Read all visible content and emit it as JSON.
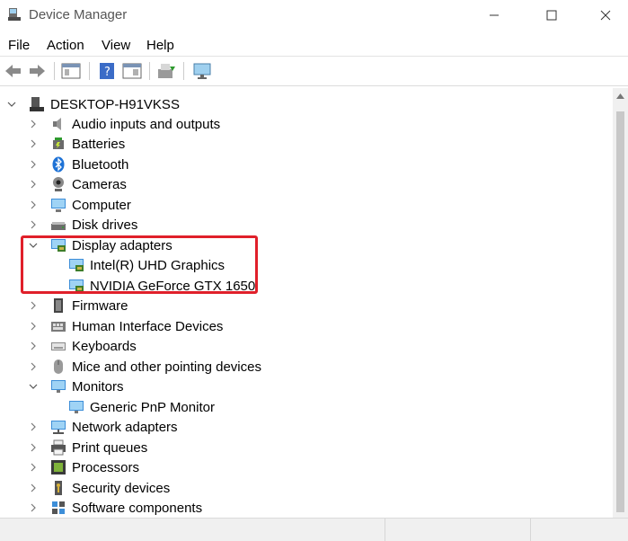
{
  "window": {
    "title": "Device Manager"
  },
  "menu": [
    "File",
    "Action",
    "View",
    "Help"
  ],
  "tree": {
    "root": "DESKTOP-H91VKSS",
    "items": [
      {
        "label": "Audio inputs and outputs",
        "icon": "speaker-icon",
        "expanded": false
      },
      {
        "label": "Batteries",
        "icon": "battery-icon",
        "expanded": false
      },
      {
        "label": "Bluetooth",
        "icon": "bluetooth-icon",
        "expanded": false
      },
      {
        "label": "Cameras",
        "icon": "camera-icon",
        "expanded": false
      },
      {
        "label": "Computer",
        "icon": "computer-icon",
        "expanded": false
      },
      {
        "label": "Disk drives",
        "icon": "disk-drive-icon",
        "expanded": false
      },
      {
        "label": "Display adapters",
        "icon": "display-adapter-icon",
        "expanded": true,
        "children": [
          {
            "label": "Intel(R) UHD Graphics",
            "icon": "display-adapter-icon"
          },
          {
            "label": "NVIDIA GeForce GTX 1650",
            "icon": "display-adapter-icon"
          }
        ]
      },
      {
        "label": "Firmware",
        "icon": "firmware-icon",
        "expanded": false
      },
      {
        "label": "Human Interface Devices",
        "icon": "hid-icon",
        "expanded": false
      },
      {
        "label": "Keyboards",
        "icon": "keyboard-icon",
        "expanded": false
      },
      {
        "label": "Mice and other pointing devices",
        "icon": "mouse-icon",
        "expanded": false
      },
      {
        "label": "Monitors",
        "icon": "monitor-icon",
        "expanded": true,
        "children": [
          {
            "label": "Generic PnP Monitor",
            "icon": "monitor-icon"
          }
        ]
      },
      {
        "label": "Network adapters",
        "icon": "network-adapter-icon",
        "expanded": false
      },
      {
        "label": "Print queues",
        "icon": "printer-icon",
        "expanded": false
      },
      {
        "label": "Processors",
        "icon": "processor-icon",
        "expanded": false
      },
      {
        "label": "Security devices",
        "icon": "security-device-icon",
        "expanded": false
      },
      {
        "label": "Software components",
        "icon": "software-component-icon",
        "expanded": false
      }
    ]
  },
  "colors": {
    "highlight": "#e0202a"
  }
}
